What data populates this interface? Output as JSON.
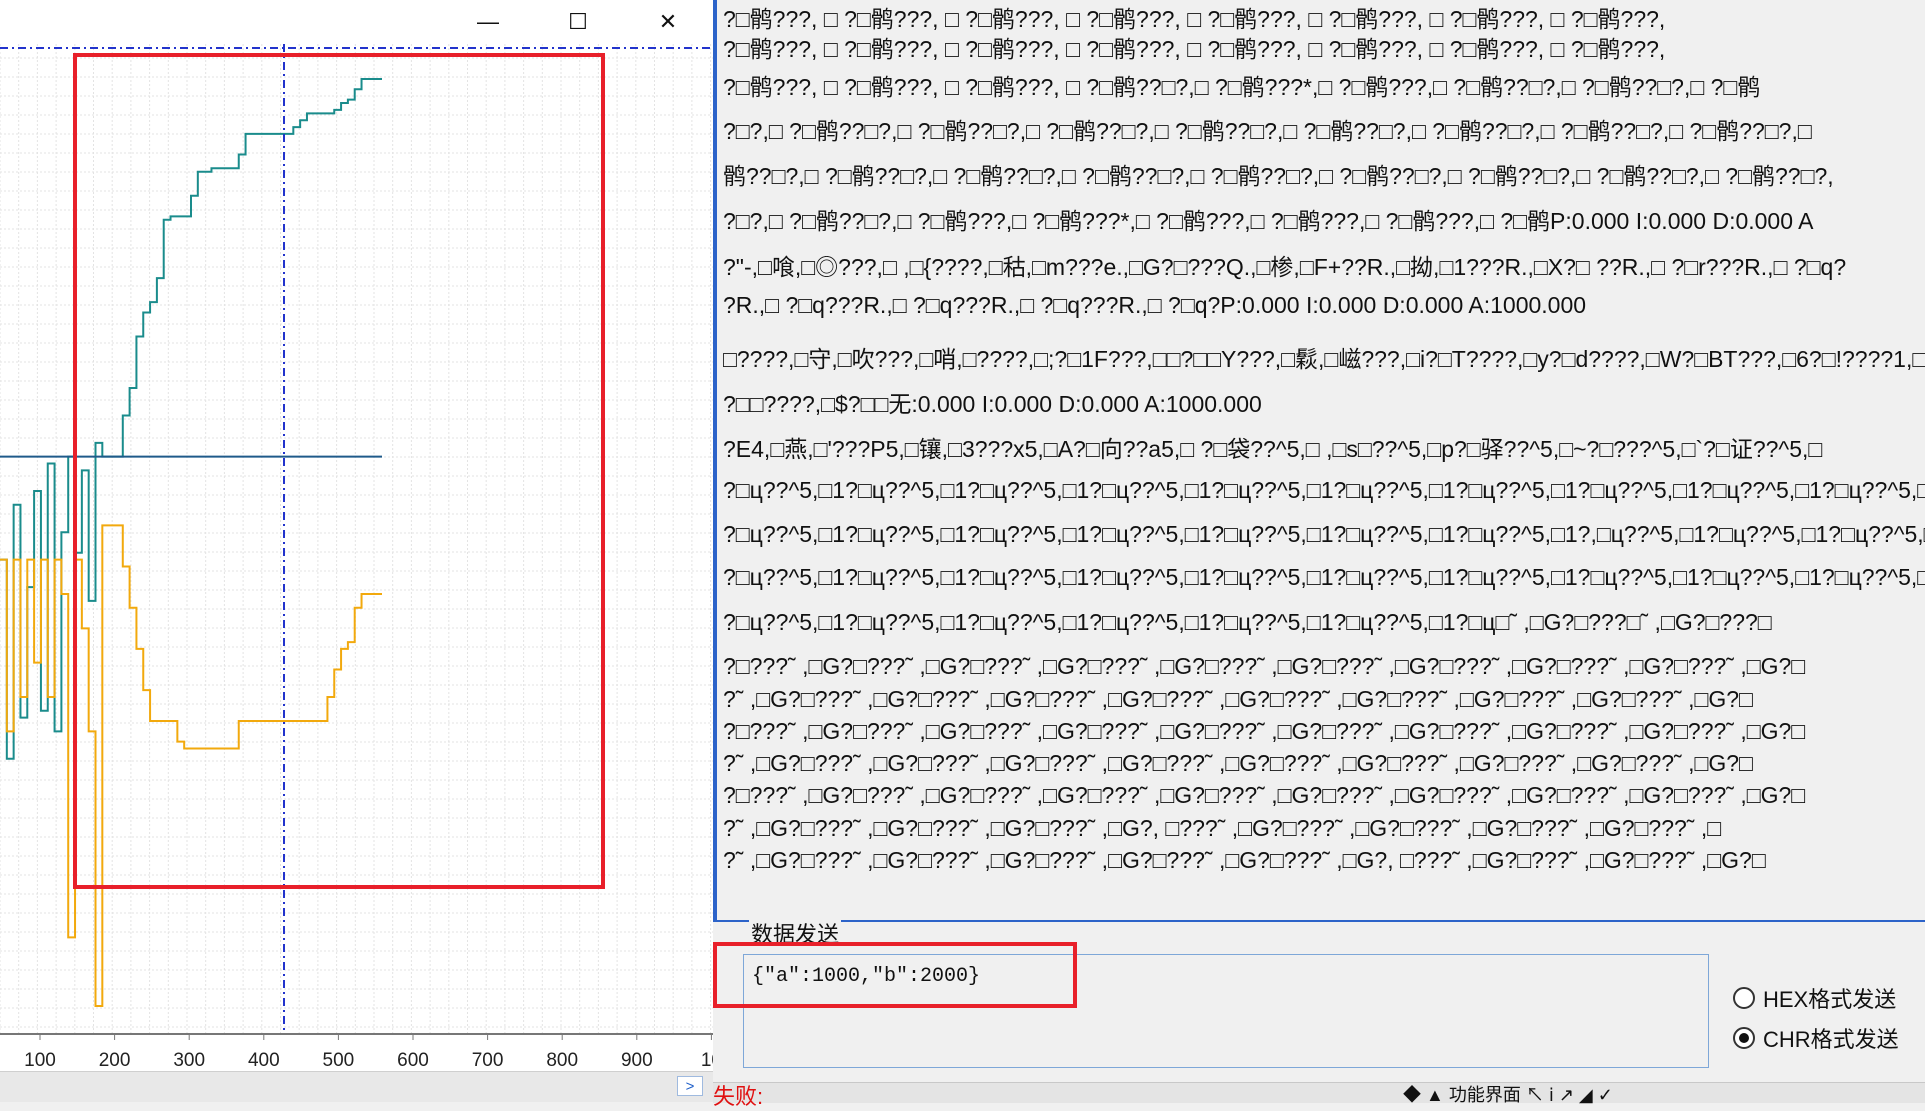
{
  "window_controls": {
    "minimize_glyph": "—",
    "maximize_glyph": "☐",
    "close_glyph": "✕"
  },
  "chart_data": {
    "type": "line",
    "x_tick_labels": [
      "100",
      "200",
      "300",
      "400",
      "500",
      "600",
      "700",
      "800",
      "900",
      "10"
    ],
    "x": [
      0,
      10,
      20,
      30,
      40,
      50,
      60,
      70,
      80,
      90,
      100,
      110,
      120,
      130,
      140,
      150,
      160,
      170,
      180,
      190,
      200,
      210,
      220,
      230,
      240,
      250,
      260,
      270,
      280,
      290,
      300,
      310,
      320,
      330,
      340,
      350,
      360,
      370,
      380,
      390,
      400,
      410,
      420,
      430,
      440,
      450,
      460,
      470,
      480,
      490,
      500,
      510,
      520,
      530,
      540,
      550,
      560
    ],
    "series": [
      {
        "color": "#1a8c8c",
        "values": [
          700,
          120,
          860,
          240,
          620,
          900,
          260,
          980,
          200,
          780,
          1000,
          720,
          960,
          580,
          1040,
          1000,
          1000,
          1000,
          1120,
          1200,
          1350,
          1420,
          1450,
          1520,
          1690,
          1700,
          1700,
          1700,
          1760,
          1830,
          1830,
          1840,
          1840,
          1840,
          1840,
          1880,
          1940,
          1940,
          1940,
          1940,
          1940,
          1940,
          1940,
          1960,
          1980,
          2000,
          2000,
          2000,
          2000,
          2010,
          2030,
          2040,
          2070,
          2100,
          2100,
          2100,
          2100
        ]
      },
      {
        "color": "#f2a90d",
        "values": [
          700,
          200,
          700,
          300,
          700,
          400,
          700,
          300,
          700,
          600,
          -400,
          700,
          500,
          200,
          -600,
          800,
          800,
          800,
          680,
          560,
          440,
          320,
          230,
          230,
          230,
          230,
          170,
          150,
          150,
          150,
          150,
          150,
          150,
          150,
          150,
          230,
          230,
          230,
          230,
          230,
          230,
          230,
          230,
          230,
          230,
          230,
          230,
          230,
          300,
          380,
          440,
          460,
          560,
          600,
          600,
          600,
          600
        ]
      },
      {
        "color": "#1f5a8a",
        "values": [
          1000,
          1000,
          1000,
          1000,
          1000,
          1000,
          1000,
          1000,
          1000,
          1000,
          1000,
          1000,
          1000,
          1000,
          1000,
          1000,
          1000,
          1000,
          1000,
          1000,
          1000,
          1000,
          1000,
          1000,
          1000,
          1000,
          1000,
          1000,
          1000,
          1000,
          1000,
          1000,
          1000,
          1000,
          1000,
          1000,
          1000,
          1000,
          1000,
          1000,
          1000,
          1000,
          1000,
          1000,
          1000,
          1000,
          1000,
          1000,
          1000,
          1000,
          1000,
          1000,
          1000,
          1000,
          1000,
          1000,
          1000
        ]
      }
    ],
    "grid": true
  },
  "scrollbar": {
    "right_arrow": ">"
  },
  "receive_lines": [
    "?□鹘???, □   ?□鹘???, □   ?□鹘???, □   ?□鹘???, □   ?□鹘???, □   ?□鹘???, □   ?□鹘???, □   ?□鹘???,",
    "?□鹘???, □   ?□鹘???, □   ?□鹘???, □   ?□鹘???, □   ?□鹘???, □   ?□鹘???, □   ?□鹘???, □   ?□鹘???,",
    "?□鹘???, □   ?□鹘???, □   ?□鹘???, □  ?□鹘??□?,□   ?□鹘???*,□   ?□鹘???,□   ?□鹘??□?,□   ?□鹘??□?,□   ?□鹘",
    "?□?,□   ?□鹘??□?,□   ?□鹘??□?,□   ?□鹘??□?,□   ?□鹘??□?,□   ?□鹘??□?,□   ?□鹘??□?,□   ?□鹘??□?,□   ?□鹘??□?,□",
    "鹘??□?,□   ?□鹘??□?,□   ?□鹘??□?,□   ?□鹘??□?,□   ?□鹘??□?,□   ?□鹘??□?,□   ?□鹘??□?,□   ?□鹘??□?,□   ?□鹘??□?,",
    "?□?,□   ?□鹘??□?,□   ?□鹘???,□   ?□鹘???*,□   ?□鹘???,□   ?□鹘???,□   ?□鹘???,□   ?□鹘P:0.000   I:0.000   D:0.000 A",
    "?\"-,□喰,□◎???,□    ,□{????,□秙,□m???e.,□G?□???Q.,□椮,□F+??R.,□拗,□1???R.,□X?□    ??R.,□   ?□r???R.,□   ?□q?",
    "?R.,□   ?□q???R.,□   ?□q???R.,□   ?□q???R.,□   ?□q?P:0.000   I:0.000   D:0.000 A:1000.000",
    "□????,□守,□吹???,□哨,□????,□;?□1F???,□□?□□Y???,□鬏,□嵫???,□i?□T????,□y?□d????,□W?□BT???,□6?□!????1,□",
    "?□□????,□$?□□无:0.000   I:0.000   D:0.000 A:1000.000",
    "?E4,□燕,□'???P5,□镶,□3???x5,□A?□向??a5,□   ?□袋??^5,□    ,□s□??^5,□p?□驿??^5,□~?□???^5,□`?□证??^5,□",
    "?□ц??^5,□1?□ц??^5,□1?□ц??^5,□1?□ц??^5,□1?□ц??^5,□1?□ц??^5,□1?□ц??^5,□1?□ц??^5,□1?□ц??^5,□1?□ц??^5,□",
    "?□ц??^5,□1?□ц??^5,□1?□ц??^5,□1?□ц??^5,□1?□ц??^5,□1?□ц??^5,□1?□ц??^5,□1?,□ц??^5,□1?□ц??^5,□1?□ц??^5,□",
    "?□ц??^5,□1?□ц??^5,□1?□ц??^5,□1?□ц??^5,□1?□ц??^5,□1?□ц??^5,□1?□ц??^5,□1?□ц??^5,□1?□ц??^5,□1?□ц??^5,□",
    "?□ц??^5,□1?□ц??^5,□1?□ц??^5,□1?□ц??^5,□1?□ц??^5,□1?□ц??^5,□1?□ц□˜ ,□G?□???□˜ ,□G?□???□",
    "?□???˜ ,□G?□???˜ ,□G?□???˜ ,□G?□???˜ ,□G?□???˜ ,□G?□???˜ ,□G?□???˜ ,□G?□???˜ ,□G?□???˜ ,□G?□",
    "?˜ ,□G?□???˜ ,□G?□???˜ ,□G?□???˜ ,□G?□???˜ ,□G?□???˜ ,□G?□???˜ ,□G?□???˜ ,□G?□???˜ ,□G?□",
    "?□???˜ ,□G?□???˜ ,□G?□???˜ ,□G?□???˜ ,□G?□???˜ ,□G?□???˜ ,□G?□???˜ ,□G?□???˜ ,□G?□???˜ ,□G?□",
    "?˜ ,□G?□???˜ ,□G?□???˜ ,□G?□???˜ ,□G?□???˜ ,□G?□???˜ ,□G?□???˜ ,□G?□???˜ ,□G?□???˜ ,□G?□",
    "?□???˜ ,□G?□???˜ ,□G?□???˜ ,□G?□???˜ ,□G?□???˜ ,□G?□???˜ ,□G?□???˜ ,□G?□???˜ ,□G?□???˜ ,□G?□",
    "?˜ ,□G?□???˜ ,□G?□???˜ ,□G?□???˜ ,□G?, □???˜ ,□G?□???˜ ,□G?□???˜ ,□G?□???˜ ,□G?□???˜ ,□",
    "?˜ ,□G?□???˜ ,□G?□???˜ ,□G?□???˜ ,□G?□???˜ ,□G?□???˜ ,□G?, □???˜ ,□G?□???˜ ,□G?□???˜ ,□G?□"
  ],
  "send_group": {
    "title": "数据发送",
    "input_value": "{\"a\":1000,\"b\":2000}",
    "hex_label": "HEX格式发送",
    "chr_label": "CHR格式发送",
    "selected": "CHR"
  },
  "status": {
    "fail_text": "失败:",
    "toolbar_text": "◆  ▲ 功能界面   ↖ ⅰ ↗ ◢ ✓"
  },
  "colors": {
    "annotation_red": "#e8202a",
    "accent_blue": "#2c63c9"
  }
}
